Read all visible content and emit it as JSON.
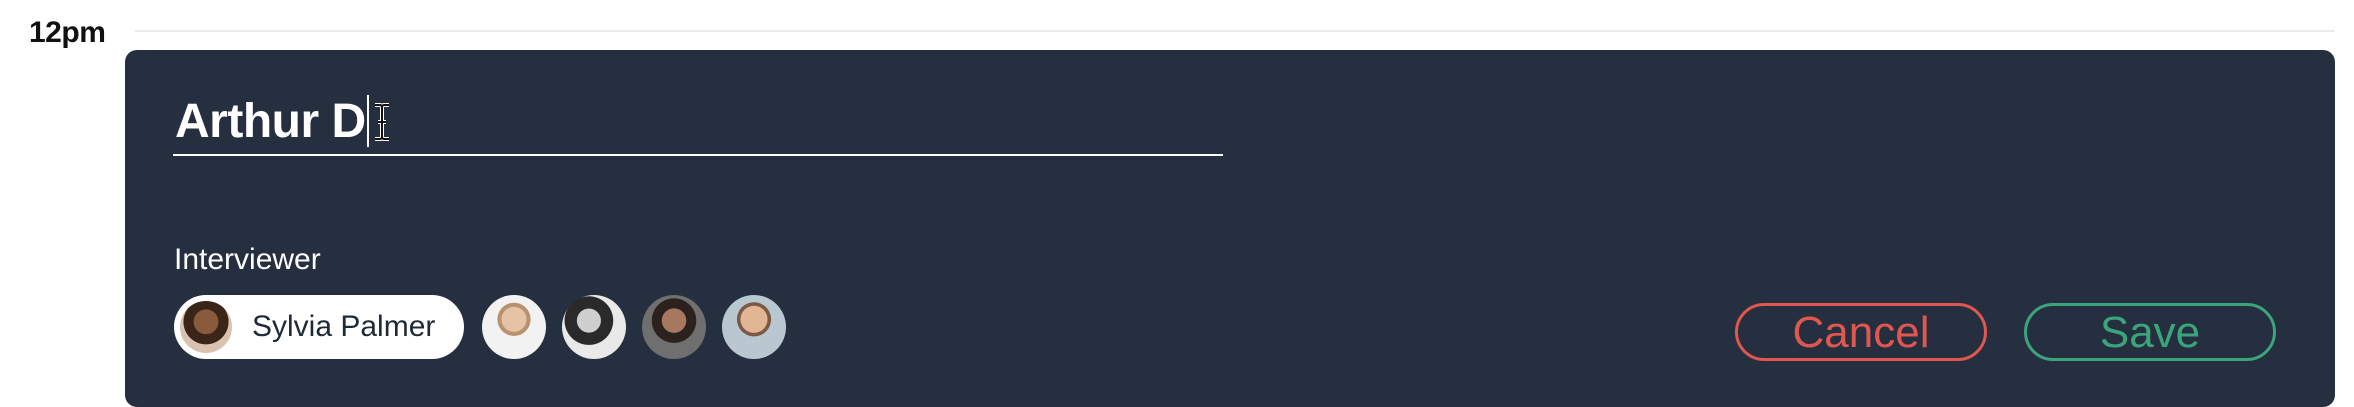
{
  "calendar": {
    "time_label": "12pm"
  },
  "event_editor": {
    "title_value": "Arthur D",
    "interviewer_label": "Interviewer",
    "selected_interviewer": {
      "name": "Sylvia Palmer"
    },
    "other_interviewer_avatars": [
      "avatar",
      "avatar",
      "avatar",
      "avatar"
    ],
    "cancel_label": "Cancel",
    "save_label": "Save"
  },
  "colors": {
    "panel_bg": "#252f3f",
    "cancel": "#e0574f",
    "save": "#3aa57a"
  },
  "icons": {
    "cursor": "ibeam-cursor-icon"
  }
}
